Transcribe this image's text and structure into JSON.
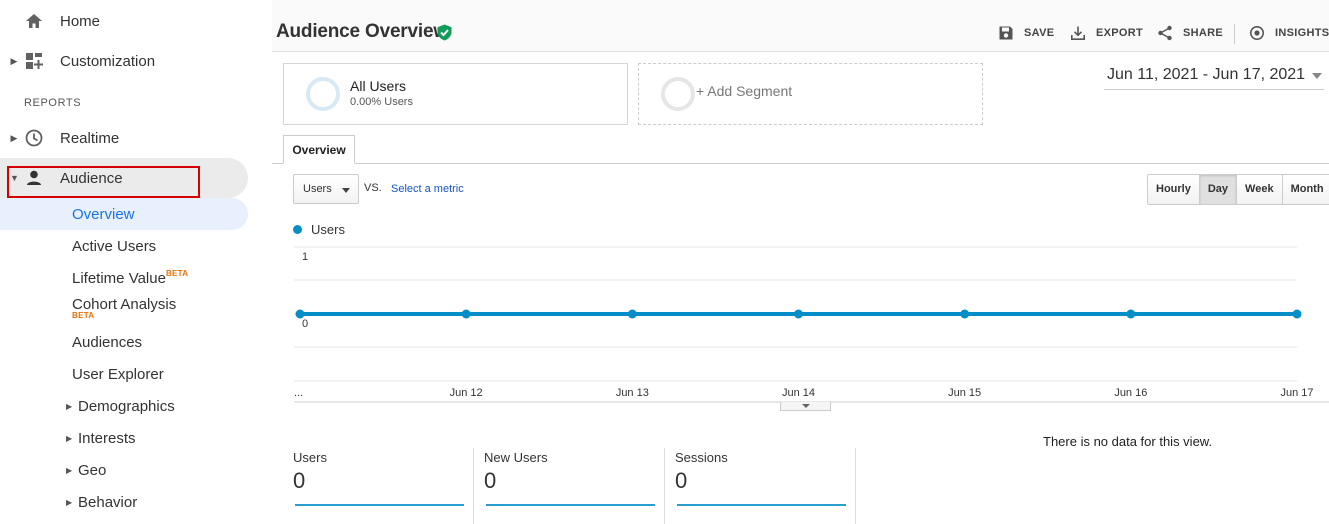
{
  "sidebar": {
    "home": "Home",
    "customization": "Customization",
    "reports_label": "REPORTS",
    "realtime": "Realtime",
    "audience": "Audience",
    "audience_items": {
      "overview": "Overview",
      "active_users": "Active Users",
      "lifetime_value": "Lifetime Value",
      "lifetime_value_badge": "BETA",
      "cohort_analysis": "Cohort Analysis",
      "cohort_analysis_badge": "BETA",
      "audiences": "Audiences",
      "user_explorer": "User Explorer",
      "demographics": "Demographics",
      "interests": "Interests",
      "geo": "Geo",
      "behavior": "Behavior"
    }
  },
  "header": {
    "title": "Audience Overview",
    "verified_icon": "verified-shield-icon",
    "actions": {
      "save": "SAVE",
      "export": "EXPORT",
      "share": "SHARE",
      "insights": "INSIGHTS"
    }
  },
  "segments": {
    "all_users_name": "All Users",
    "all_users_sub": "0.00% Users",
    "add_segment": "+ Add Segment"
  },
  "date_range": "Jun 11, 2021 - Jun 17, 2021",
  "tabs": {
    "overview": "Overview"
  },
  "controls": {
    "metric": "Users",
    "vs": "VS.",
    "select_metric": "Select a metric",
    "granularity": [
      "Hourly",
      "Day",
      "Week",
      "Month"
    ],
    "granularity_active": "Day"
  },
  "chart_data": {
    "type": "line",
    "series": [
      {
        "name": "Users",
        "values": [
          0,
          0,
          0,
          0,
          0,
          0,
          0
        ],
        "color": "#058dc7"
      }
    ],
    "x": [
      "...",
      "Jun 12",
      "Jun 13",
      "Jun 14",
      "Jun 15",
      "Jun 16",
      "Jun 17"
    ],
    "y_ticks": [
      "1",
      "0"
    ],
    "ylim": [
      0,
      1
    ],
    "grid": true,
    "legend": "top-left"
  },
  "scorecards": [
    {
      "label": "Users",
      "value": "0"
    },
    {
      "label": "New Users",
      "value": "0"
    },
    {
      "label": "Sessions",
      "value": "0"
    }
  ],
  "no_data_message": "There is no data for this view."
}
